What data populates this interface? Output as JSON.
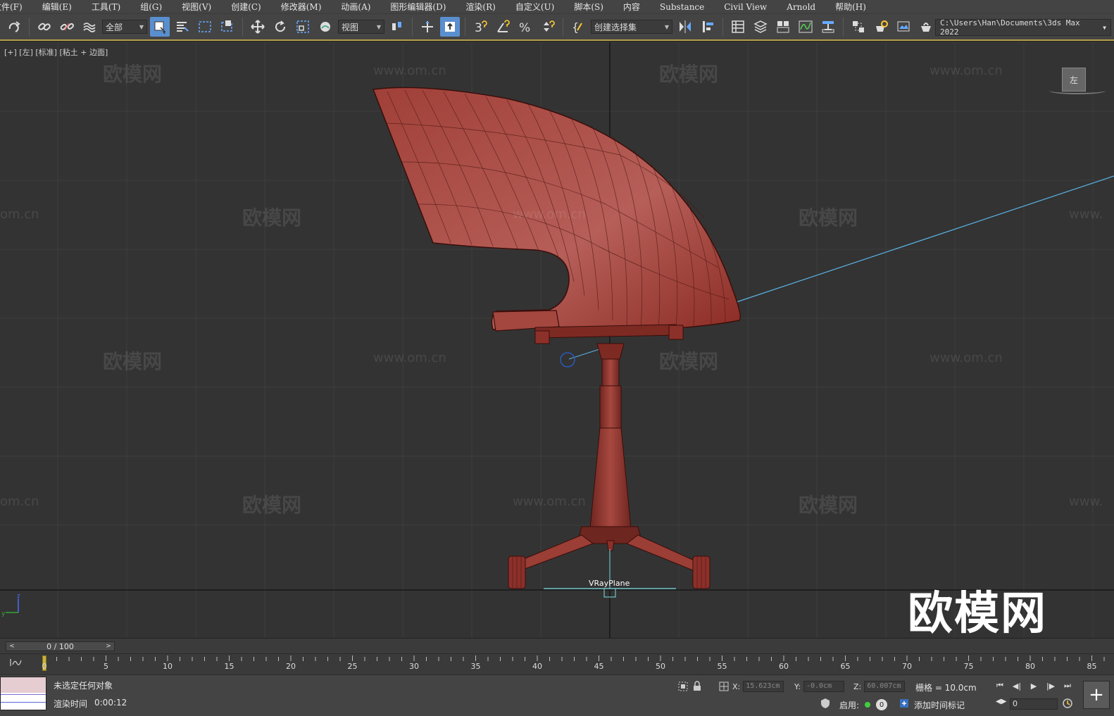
{
  "menu": [
    "文件(F)",
    "编辑(E)",
    "工具(T)",
    "组(G)",
    "视图(V)",
    "创建(C)",
    "修改器(M)",
    "动画(A)",
    "图形编辑器(D)",
    "渲染(R)",
    "自定义(U)",
    "脚本(S)",
    "内容",
    "Substance",
    "Civil View",
    "Arnold",
    "帮助(H)"
  ],
  "toolbar": {
    "selection_filter": "全部",
    "reference_coord": "视图",
    "named_selection": "创建选择集",
    "project_path": "C:\\Users\\Han\\Documents\\3ds Max 2022"
  },
  "viewport": {
    "label": "[+] [左] [标准] [粘土 + 边面]",
    "viewcube_label": "左",
    "object_label": "VRayPlane",
    "watermark_text": "欧模网",
    "watermark_url": "www.om.cn",
    "watermark_url_cut": "om.cn",
    "watermark_url_right": "www.",
    "brand_watermark": "欧模网"
  },
  "time_slider": {
    "position": "0 / 100",
    "prev": "<",
    "next": ">"
  },
  "trackbar": {
    "ticks": [
      "0",
      "5",
      "10",
      "15",
      "20",
      "25",
      "30",
      "35",
      "40",
      "45",
      "50",
      "55",
      "60",
      "65",
      "70",
      "75",
      "80",
      "85"
    ]
  },
  "status": {
    "selection_message": "未选定任何对象",
    "render_time_label": "渲染时间",
    "render_time_value": "0:00:12",
    "x_label": "X:",
    "x_value": "15.623cm",
    "y_label": "Y:",
    "y_value": "-0.0cm",
    "z_label": "Z:",
    "z_value": "60.007cm",
    "grid_label": "栅格 = 10.0cm",
    "enable_label": "启用:",
    "enable_count": "0",
    "add_time_tag": "添加时间标记",
    "current_frame": "0"
  },
  "colors": {
    "chair": "#8b2f28",
    "chair_light": "#c0605a",
    "viewport_bg": "#333333",
    "grid_line": "#3e3e3e",
    "axis_line": "#111111",
    "light_ray": "#5ab4e6",
    "toolbar_active": "#5a8fcf",
    "timeline_accent": "#b59d4a"
  }
}
